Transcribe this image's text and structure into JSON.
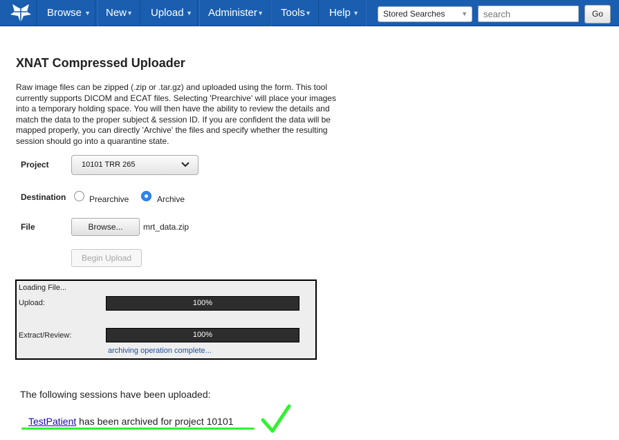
{
  "nav": {
    "items": [
      {
        "label": "Browse"
      },
      {
        "label": "New"
      },
      {
        "label": "Upload"
      },
      {
        "label": "Administer"
      },
      {
        "label": "Tools"
      },
      {
        "label": "Help"
      }
    ],
    "stored_searches": "Stored Searches",
    "search_placeholder": "search",
    "go_label": "Go"
  },
  "page": {
    "title": "XNAT Compressed Uploader",
    "description": "Raw image files can be zipped (.zip or .tar.gz) and uploaded using the form. This tool currently supports DICOM and ECAT files. Selecting 'Prearchive' will place your images into a temporary holding space. You will then have the ability to review the details and match the data to the proper subject & session ID. If you are confident the data will be mapped properly, you can directly 'Archive' the files and specify whether the resulting session should go into a quarantine state."
  },
  "form": {
    "project_label": "Project",
    "project_value": "10101 TRR 265",
    "destination_label": "Destination",
    "destination_options": [
      "Prearchive",
      "Archive"
    ],
    "destination_selected": "Archive",
    "file_label": "File",
    "browse_label": "Browse...",
    "file_name": "mrt_data.zip",
    "begin_upload_label": "Begin Upload"
  },
  "progress": {
    "loading_text": "Loading File...",
    "upload_label": "Upload:",
    "upload_percent": "100%",
    "upload_fraction": 1.0,
    "extract_label": "Extract/Review:",
    "extract_percent": "100%",
    "extract_fraction": 1.0,
    "status_text": "archiving operation complete..."
  },
  "result": {
    "heading": "The following sessions have been uploaded:",
    "patient_link": "TestPatient",
    "middle_text": "has been archived for project",
    "project_id": "10101"
  },
  "colors": {
    "nav_bg": "#1a5eb0",
    "highlight_green": "#2ff22f",
    "link": "#1a0dab"
  }
}
